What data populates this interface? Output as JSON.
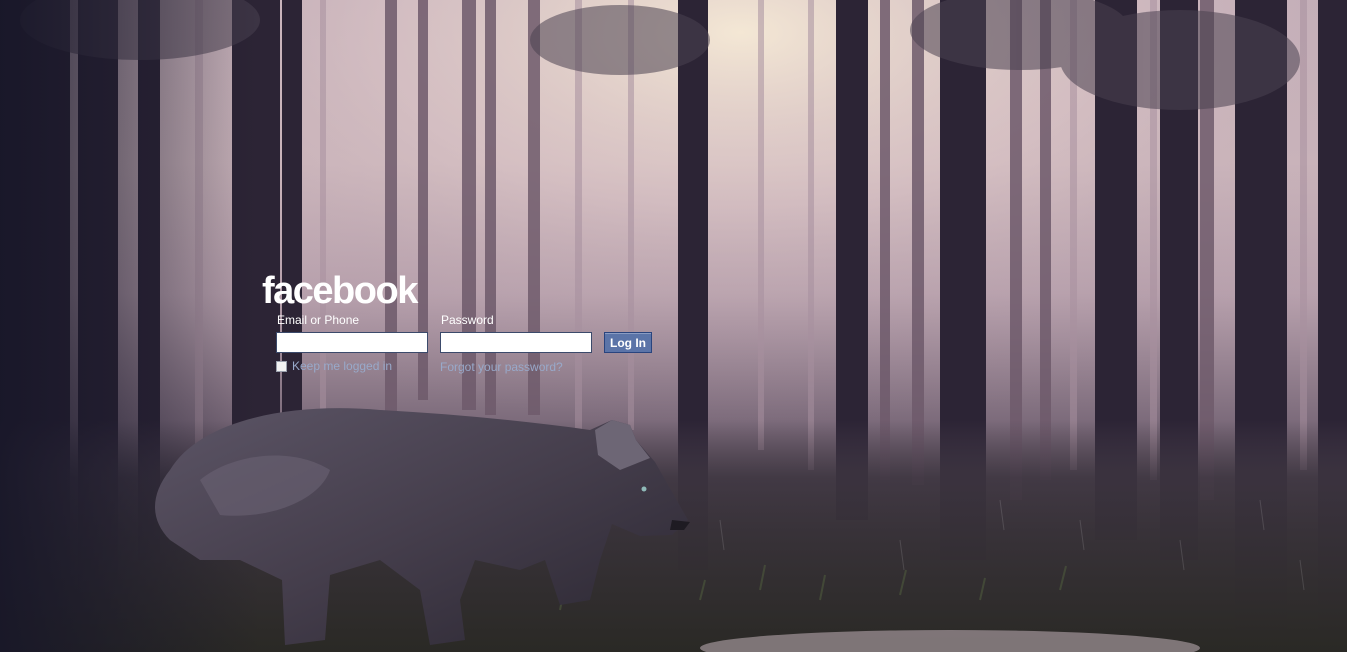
{
  "brand": {
    "logo_text": "facebook"
  },
  "login_form": {
    "email_label": "Email or Phone",
    "email_value": "",
    "password_label": "Password",
    "password_value": "",
    "login_button": "Log In",
    "keep_logged_in_label": "Keep me logged in",
    "keep_logged_in_checked": false,
    "forgot_password_link": "Forgot your password?"
  },
  "background": {
    "description_icon": "forest-wolf-background-image"
  },
  "colors": {
    "button_bg": "#5b74a8",
    "link": "#98a9ca",
    "label": "#ffffff"
  }
}
